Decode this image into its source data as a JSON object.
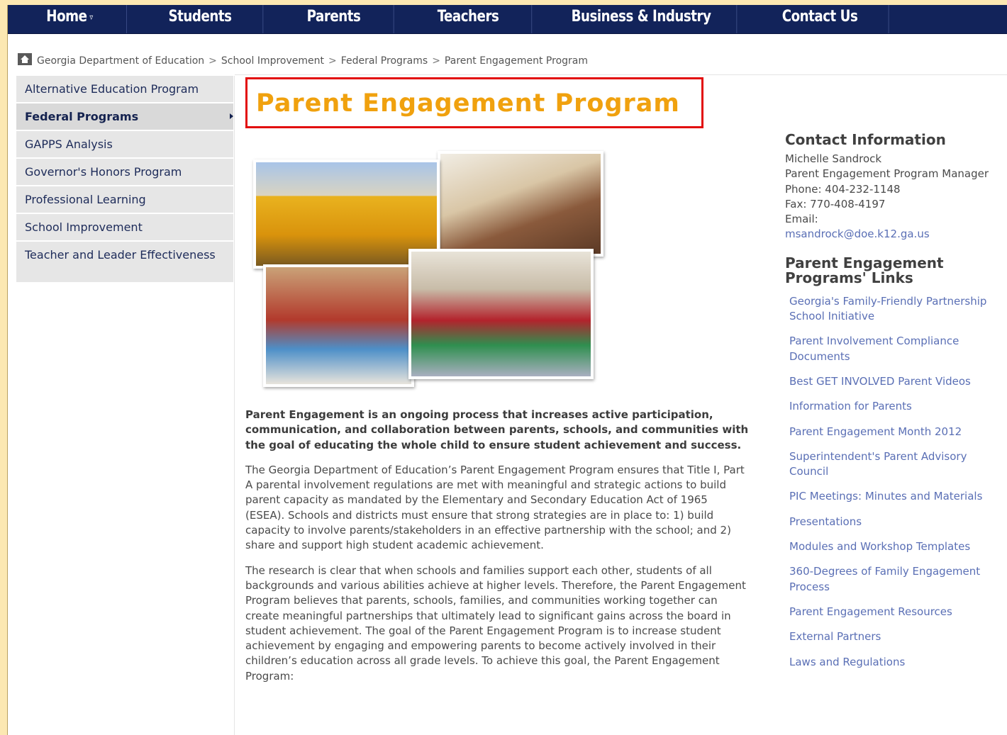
{
  "nav": {
    "items": [
      {
        "label": "Home"
      },
      {
        "label": "Students"
      },
      {
        "label": "Parents"
      },
      {
        "label": "Teachers"
      },
      {
        "label": "Business & Industry"
      },
      {
        "label": "Contact Us"
      }
    ]
  },
  "breadcrumb": {
    "items": [
      "Georgia Department of Education",
      "School Improvement",
      "Federal Programs",
      "Parent Engagement Program"
    ],
    "separator": ">"
  },
  "sidebar": {
    "items": [
      {
        "label": "Alternative Education Program"
      },
      {
        "label": "Federal Programs"
      },
      {
        "label": "GAPPS Analysis"
      },
      {
        "label": "Governor's Honors Program"
      },
      {
        "label": "Professional Learning"
      },
      {
        "label": "School Improvement"
      },
      {
        "label": "Teacher and Leader Effectiveness"
      }
    ]
  },
  "page": {
    "title": "Parent Engagement Program",
    "intro": "Parent Engagement is an ongoing process that increases active participation, communication, and collaboration between parents, schools, and communities with the goal of educating the whole child to ensure student achievement and success.",
    "paragraphs": [
      "The Georgia Department of Education’s Parent Engagement Program ensures that Title I, Part A parental involvement regulations are met with meaningful and strategic actions to build parent capacity as mandated by the Elementary and Secondary Education Act of 1965 (ESEA).  Schools and districts must ensure that strong strategies are in place to: 1) build capacity to involve parents/stakeholders in an effective partnership with the school; and 2) share and support high student academic achievement.",
      "The research is clear that when schools and families support each other, students of all backgrounds and various abilities achieve at higher levels. Therefore, the Parent Engagement Program believes that parents, schools, families, and communities working together can create meaningful partnerships that ultimately lead to significant gains across the board in student achievement.  The goal of the Parent Engagement Program is to increase student achievement by engaging and empowering parents to become actively involved in their children’s education across all grade levels. To achieve this goal, the Parent Engagement Program:"
    ]
  },
  "contact": {
    "heading": "Contact Information",
    "name": "Michelle Sandrock",
    "role": "Parent Engagement Program Manager",
    "phone": "Phone: 404-232-1148",
    "fax": "Fax: 770-408-4197",
    "email_label": "Email:",
    "email": "msandrock@doe.k12.ga.us"
  },
  "links": {
    "heading": "Parent Engagement Programs' Links",
    "items": [
      "Georgia's Family-Friendly Partnership School Initiative",
      "Parent Involvement Compliance Documents",
      "Best GET INVOLVED Parent Videos",
      "Information for Parents",
      "Parent Engagement Month 2012",
      "Superintendent's Parent Advisory Council",
      "PIC Meetings: Minutes and Materials",
      "Presentations",
      "Modules and Workshop Templates",
      "360-Degrees of Family Engagement Process",
      "Parent Engagement Resources",
      "External Partners",
      "Laws and Regulations"
    ]
  },
  "colors": {
    "nav_bg": "#12235a",
    "title": "#f0a10e",
    "highlight_box": "#e20c0c",
    "link": "#5a6fb5"
  }
}
